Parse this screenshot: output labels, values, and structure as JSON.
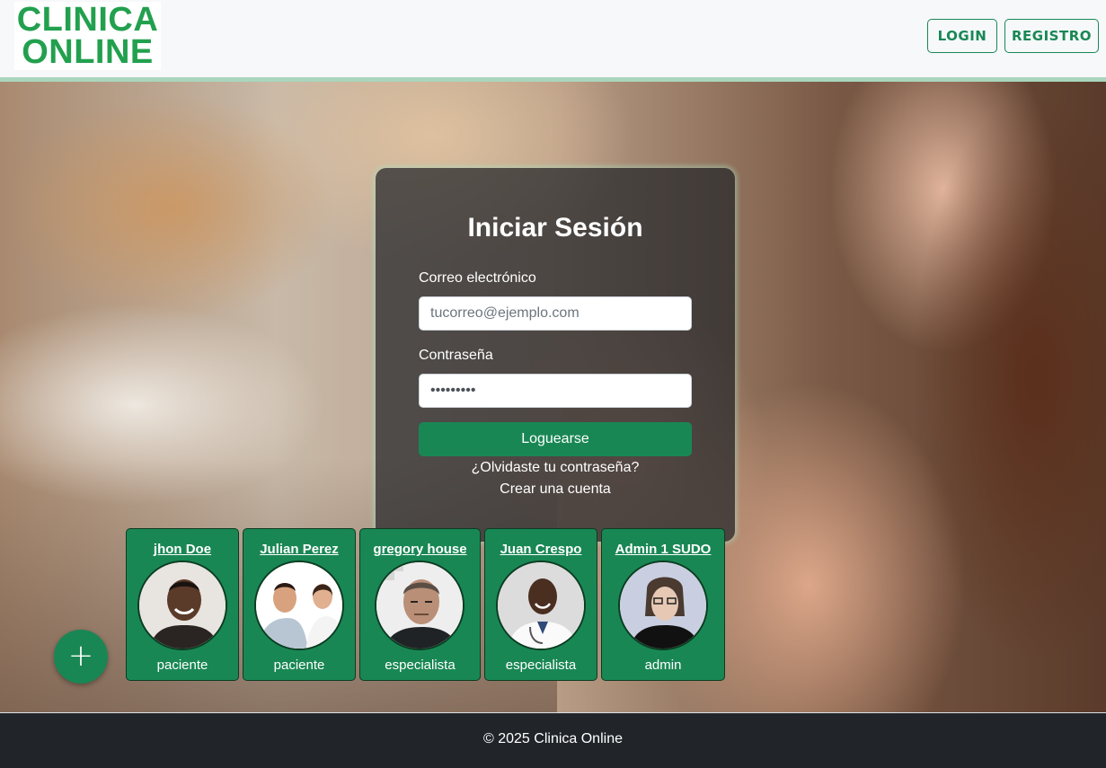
{
  "brand": {
    "line1": "CLINICA",
    "line2": "ONLINE",
    "color": "#22a04e"
  },
  "nav": {
    "login_label": "LOGIN",
    "register_label": "REGISTRO"
  },
  "login": {
    "title": "Iniciar Sesión",
    "email_label": "Correo electrónico",
    "email_placeholder": "tucorreo@ejemplo.com",
    "password_label": "Contraseña",
    "password_value": "•••••••••",
    "submit_label": "Loguearse",
    "forgot_label": "¿Olvidaste tu contraseña?",
    "create_label": "Crear una cuenta"
  },
  "quick_users": [
    {
      "name": "jhon Doe",
      "role": "paciente",
      "avatar": "man-smiling-avatar"
    },
    {
      "name": "Julian Perez",
      "role": "paciente",
      "avatar": "doctor-patient-avatar"
    },
    {
      "name": "gregory house",
      "role": "especialista",
      "avatar": "man-portrait-avatar"
    },
    {
      "name": "Juan Crespo",
      "role": "especialista",
      "avatar": "doctor-avatar"
    },
    {
      "name": "Admin 1 SUDO",
      "role": "admin",
      "avatar": "admin-webcam-avatar"
    }
  ],
  "fab_symbol": "+",
  "footer": {
    "text": "© 2025 Clinica Online"
  },
  "colors": {
    "primary": "#198754",
    "footer_bg": "#212529",
    "header_bg": "#f6f8fa"
  }
}
